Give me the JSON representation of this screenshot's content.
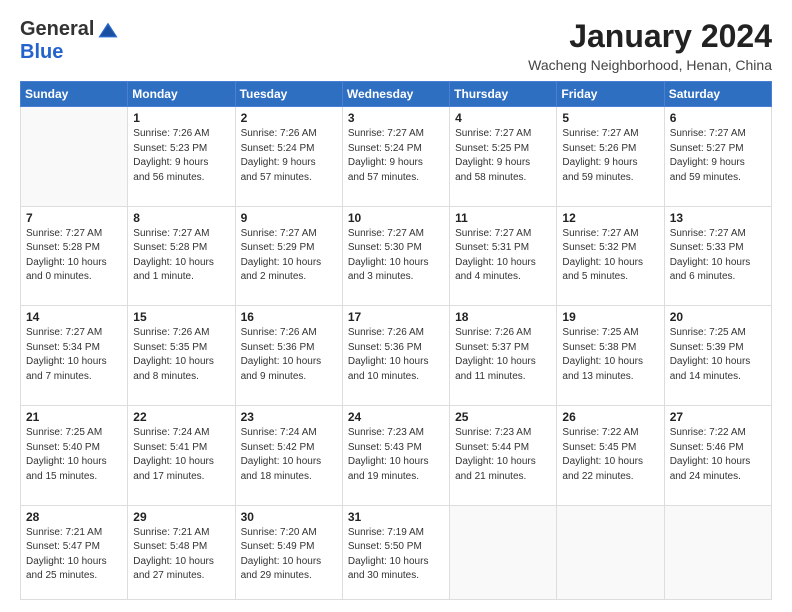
{
  "header": {
    "logo": {
      "general": "General",
      "blue": "Blue"
    },
    "title": "January 2024",
    "location": "Wacheng Neighborhood, Henan, China"
  },
  "calendar": {
    "weekdays": [
      "Sunday",
      "Monday",
      "Tuesday",
      "Wednesday",
      "Thursday",
      "Friday",
      "Saturday"
    ],
    "weeks": [
      [
        {
          "day": "",
          "info": ""
        },
        {
          "day": "1",
          "info": "Sunrise: 7:26 AM\nSunset: 5:23 PM\nDaylight: 9 hours\nand 56 minutes."
        },
        {
          "day": "2",
          "info": "Sunrise: 7:26 AM\nSunset: 5:24 PM\nDaylight: 9 hours\nand 57 minutes."
        },
        {
          "day": "3",
          "info": "Sunrise: 7:27 AM\nSunset: 5:24 PM\nDaylight: 9 hours\nand 57 minutes."
        },
        {
          "day": "4",
          "info": "Sunrise: 7:27 AM\nSunset: 5:25 PM\nDaylight: 9 hours\nand 58 minutes."
        },
        {
          "day": "5",
          "info": "Sunrise: 7:27 AM\nSunset: 5:26 PM\nDaylight: 9 hours\nand 59 minutes."
        },
        {
          "day": "6",
          "info": "Sunrise: 7:27 AM\nSunset: 5:27 PM\nDaylight: 9 hours\nand 59 minutes."
        }
      ],
      [
        {
          "day": "7",
          "info": "Sunrise: 7:27 AM\nSunset: 5:28 PM\nDaylight: 10 hours\nand 0 minutes."
        },
        {
          "day": "8",
          "info": "Sunrise: 7:27 AM\nSunset: 5:28 PM\nDaylight: 10 hours\nand 1 minute."
        },
        {
          "day": "9",
          "info": "Sunrise: 7:27 AM\nSunset: 5:29 PM\nDaylight: 10 hours\nand 2 minutes."
        },
        {
          "day": "10",
          "info": "Sunrise: 7:27 AM\nSunset: 5:30 PM\nDaylight: 10 hours\nand 3 minutes."
        },
        {
          "day": "11",
          "info": "Sunrise: 7:27 AM\nSunset: 5:31 PM\nDaylight: 10 hours\nand 4 minutes."
        },
        {
          "day": "12",
          "info": "Sunrise: 7:27 AM\nSunset: 5:32 PM\nDaylight: 10 hours\nand 5 minutes."
        },
        {
          "day": "13",
          "info": "Sunrise: 7:27 AM\nSunset: 5:33 PM\nDaylight: 10 hours\nand 6 minutes."
        }
      ],
      [
        {
          "day": "14",
          "info": "Sunrise: 7:27 AM\nSunset: 5:34 PM\nDaylight: 10 hours\nand 7 minutes."
        },
        {
          "day": "15",
          "info": "Sunrise: 7:26 AM\nSunset: 5:35 PM\nDaylight: 10 hours\nand 8 minutes."
        },
        {
          "day": "16",
          "info": "Sunrise: 7:26 AM\nSunset: 5:36 PM\nDaylight: 10 hours\nand 9 minutes."
        },
        {
          "day": "17",
          "info": "Sunrise: 7:26 AM\nSunset: 5:36 PM\nDaylight: 10 hours\nand 10 minutes."
        },
        {
          "day": "18",
          "info": "Sunrise: 7:26 AM\nSunset: 5:37 PM\nDaylight: 10 hours\nand 11 minutes."
        },
        {
          "day": "19",
          "info": "Sunrise: 7:25 AM\nSunset: 5:38 PM\nDaylight: 10 hours\nand 13 minutes."
        },
        {
          "day": "20",
          "info": "Sunrise: 7:25 AM\nSunset: 5:39 PM\nDaylight: 10 hours\nand 14 minutes."
        }
      ],
      [
        {
          "day": "21",
          "info": "Sunrise: 7:25 AM\nSunset: 5:40 PM\nDaylight: 10 hours\nand 15 minutes."
        },
        {
          "day": "22",
          "info": "Sunrise: 7:24 AM\nSunset: 5:41 PM\nDaylight: 10 hours\nand 17 minutes."
        },
        {
          "day": "23",
          "info": "Sunrise: 7:24 AM\nSunset: 5:42 PM\nDaylight: 10 hours\nand 18 minutes."
        },
        {
          "day": "24",
          "info": "Sunrise: 7:23 AM\nSunset: 5:43 PM\nDaylight: 10 hours\nand 19 minutes."
        },
        {
          "day": "25",
          "info": "Sunrise: 7:23 AM\nSunset: 5:44 PM\nDaylight: 10 hours\nand 21 minutes."
        },
        {
          "day": "26",
          "info": "Sunrise: 7:22 AM\nSunset: 5:45 PM\nDaylight: 10 hours\nand 22 minutes."
        },
        {
          "day": "27",
          "info": "Sunrise: 7:22 AM\nSunset: 5:46 PM\nDaylight: 10 hours\nand 24 minutes."
        }
      ],
      [
        {
          "day": "28",
          "info": "Sunrise: 7:21 AM\nSunset: 5:47 PM\nDaylight: 10 hours\nand 25 minutes."
        },
        {
          "day": "29",
          "info": "Sunrise: 7:21 AM\nSunset: 5:48 PM\nDaylight: 10 hours\nand 27 minutes."
        },
        {
          "day": "30",
          "info": "Sunrise: 7:20 AM\nSunset: 5:49 PM\nDaylight: 10 hours\nand 29 minutes."
        },
        {
          "day": "31",
          "info": "Sunrise: 7:19 AM\nSunset: 5:50 PM\nDaylight: 10 hours\nand 30 minutes."
        },
        {
          "day": "",
          "info": ""
        },
        {
          "day": "",
          "info": ""
        },
        {
          "day": "",
          "info": ""
        }
      ]
    ]
  }
}
